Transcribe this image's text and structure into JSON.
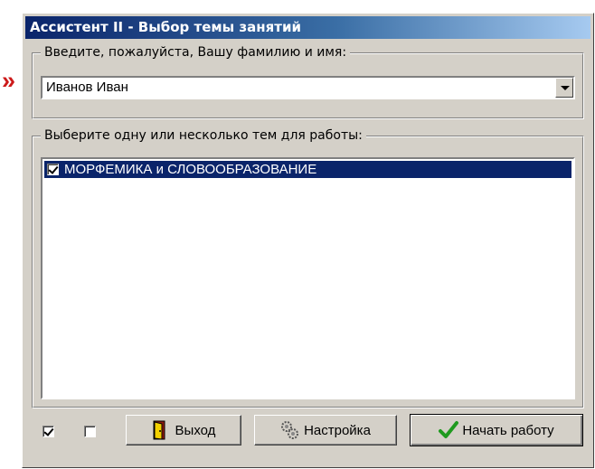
{
  "marker": "»",
  "window": {
    "title": "Ассистент II - Выбор темы занятий"
  },
  "name_group": {
    "legend": "Введите, пожалуйста, Вашу фамилию и имя:",
    "value": "Иванов Иван"
  },
  "topics_group": {
    "legend": "Выберите одну или несколько тем для работы:",
    "items": [
      {
        "label": "МОРФЕМИКА и СЛОВООБРАЗОВАНИЕ",
        "checked": true,
        "selected": true
      }
    ]
  },
  "bottom": {
    "checkbox1_checked": true,
    "checkbox2_checked": false,
    "exit_label": "Выход",
    "settings_label": "Настройка",
    "start_label": "Начать работу"
  },
  "colors": {
    "selection": "#0a246a",
    "marker": "#cc1a1a",
    "dialog_face": "#d4d0c8"
  },
  "icons": {
    "exit": "door-icon",
    "settings": "gears-icon",
    "start": "checkmark-icon"
  }
}
